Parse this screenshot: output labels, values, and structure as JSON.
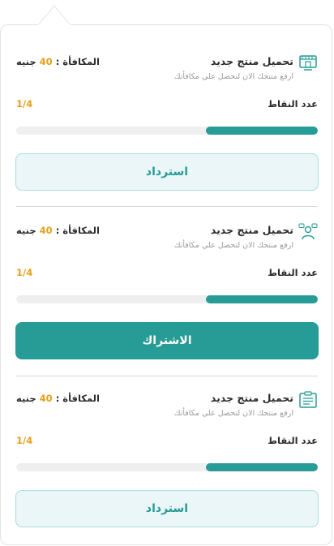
{
  "colors": {
    "accent": "#279b95",
    "reward_amount": "#e3a11b",
    "outline_button_bg": "#eaf6f7"
  },
  "cards": [
    {
      "icon": "storefront-icon",
      "title": "تحميل منتج جديد",
      "subtitle": "ارفع منتجك الان لتحصل علي مكافأتك",
      "reward_label": "المكافأة :",
      "reward_amount": "40",
      "reward_currency": "جنيه",
      "points_label": "عدد النقاط",
      "points_value": "1/4",
      "progress_fraction": 0.37,
      "button_label": "استرداد",
      "button_style": "outline"
    },
    {
      "icon": "user-chat-icon",
      "title": "تحميل منتج جديد",
      "subtitle": "ارفع منتجك الان لتحصل علي مكافأتك",
      "reward_label": "المكافأة :",
      "reward_amount": "40",
      "reward_currency": "جنيه",
      "points_label": "عدد النقاط",
      "points_value": "1/4",
      "progress_fraction": 0.37,
      "button_label": "الاشتراك",
      "button_style": "solid"
    },
    {
      "icon": "clipboard-icon",
      "title": "تحميل منتج جديد",
      "subtitle": "ارفع منتجك الان لتحصل علي مكافأتك",
      "reward_label": "المكافأة :",
      "reward_amount": "40",
      "reward_currency": "جنيه",
      "points_label": "عدد النقاط",
      "points_value": "1/4",
      "progress_fraction": 0.37,
      "button_label": "استرداد",
      "button_style": "outline"
    }
  ]
}
